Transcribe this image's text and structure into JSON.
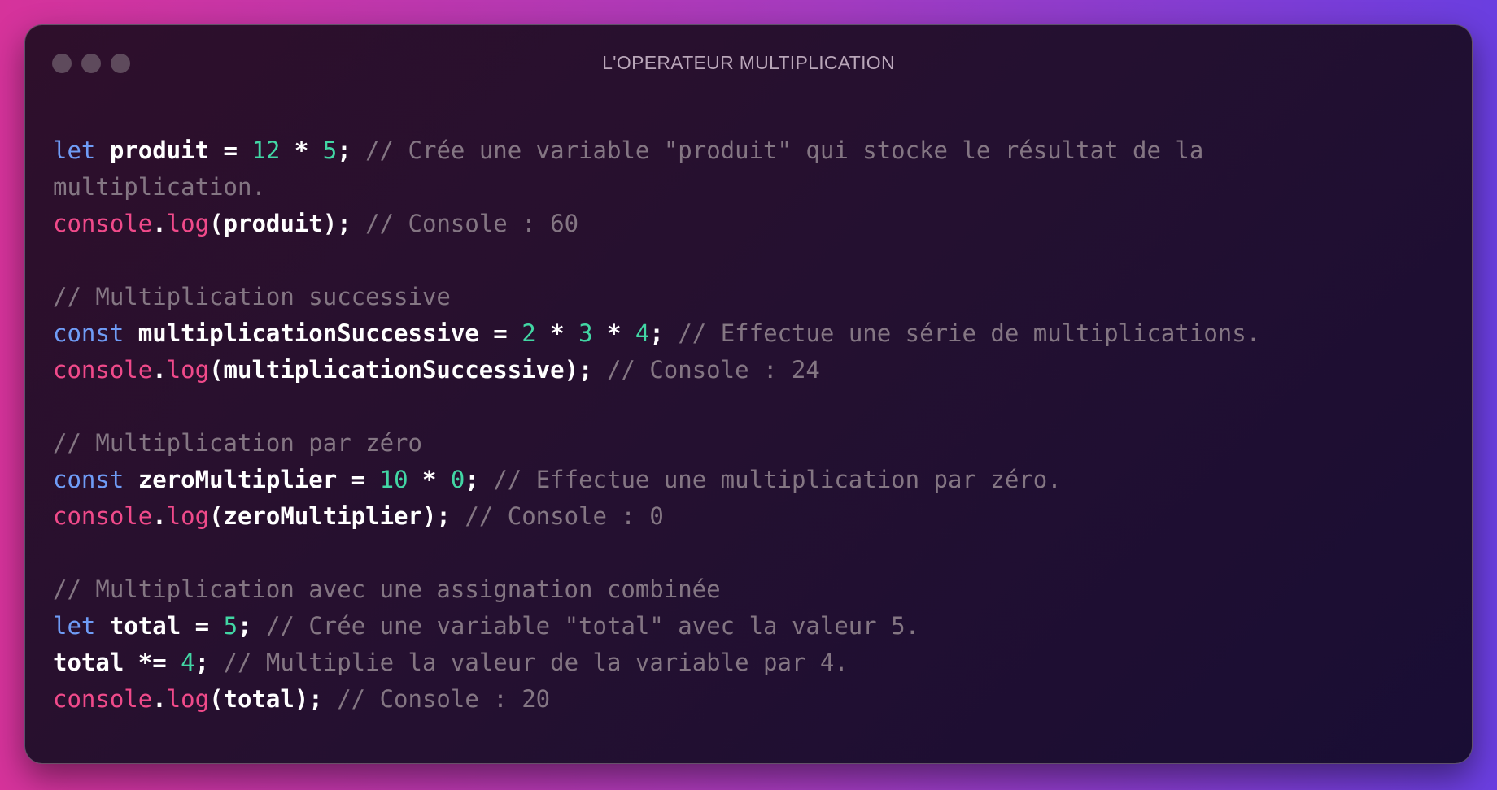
{
  "window": {
    "title": "L'OPERATEUR MULTIPLICATION"
  },
  "code": {
    "lines": [
      [
        {
          "t": "let",
          "k": "kw"
        },
        {
          "t": " ",
          "k": "punc"
        },
        {
          "t": "produit",
          "k": "id"
        },
        {
          "t": " = ",
          "k": "op"
        },
        {
          "t": "12",
          "k": "num"
        },
        {
          "t": " * ",
          "k": "op"
        },
        {
          "t": "5",
          "k": "num"
        },
        {
          "t": "; ",
          "k": "punc"
        },
        {
          "t": "// Crée une variable \"produit\" qui stocke le résultat de la",
          "k": "cm"
        }
      ],
      [
        {
          "t": "multiplication.",
          "k": "cm"
        }
      ],
      [
        {
          "t": "console",
          "k": "obj"
        },
        {
          "t": ".",
          "k": "punc"
        },
        {
          "t": "log",
          "k": "fn"
        },
        {
          "t": "(produit); ",
          "k": "punc"
        },
        {
          "t": "// Console : 60",
          "k": "cm"
        }
      ],
      [],
      [
        {
          "t": "// Multiplication successive",
          "k": "cm"
        }
      ],
      [
        {
          "t": "const",
          "k": "kw"
        },
        {
          "t": " ",
          "k": "punc"
        },
        {
          "t": "multiplicationSuccessive",
          "k": "id"
        },
        {
          "t": " = ",
          "k": "op"
        },
        {
          "t": "2",
          "k": "num"
        },
        {
          "t": " * ",
          "k": "op"
        },
        {
          "t": "3",
          "k": "num"
        },
        {
          "t": " * ",
          "k": "op"
        },
        {
          "t": "4",
          "k": "num"
        },
        {
          "t": "; ",
          "k": "punc"
        },
        {
          "t": "// Effectue une série de multiplications.",
          "k": "cm"
        }
      ],
      [
        {
          "t": "console",
          "k": "obj"
        },
        {
          "t": ".",
          "k": "punc"
        },
        {
          "t": "log",
          "k": "fn"
        },
        {
          "t": "(multiplicationSuccessive); ",
          "k": "punc"
        },
        {
          "t": "// Console : 24",
          "k": "cm"
        }
      ],
      [],
      [
        {
          "t": "// Multiplication par zéro",
          "k": "cm"
        }
      ],
      [
        {
          "t": "const",
          "k": "kw"
        },
        {
          "t": " ",
          "k": "punc"
        },
        {
          "t": "zeroMultiplier",
          "k": "id"
        },
        {
          "t": " = ",
          "k": "op"
        },
        {
          "t": "10",
          "k": "num"
        },
        {
          "t": " * ",
          "k": "op"
        },
        {
          "t": "0",
          "k": "num"
        },
        {
          "t": "; ",
          "k": "punc"
        },
        {
          "t": "// Effectue une multiplication par zéro.",
          "k": "cm"
        }
      ],
      [
        {
          "t": "console",
          "k": "obj"
        },
        {
          "t": ".",
          "k": "punc"
        },
        {
          "t": "log",
          "k": "fn"
        },
        {
          "t": "(zeroMultiplier); ",
          "k": "punc"
        },
        {
          "t": "// Console : 0",
          "k": "cm"
        }
      ],
      [],
      [
        {
          "t": "// Multiplication avec une assignation combinée",
          "k": "cm"
        }
      ],
      [
        {
          "t": "let",
          "k": "kw"
        },
        {
          "t": " ",
          "k": "punc"
        },
        {
          "t": "total",
          "k": "id"
        },
        {
          "t": " = ",
          "k": "op"
        },
        {
          "t": "5",
          "k": "num"
        },
        {
          "t": "; ",
          "k": "punc"
        },
        {
          "t": "// Crée une variable \"total\" avec la valeur 5.",
          "k": "cm"
        }
      ],
      [
        {
          "t": "total",
          "k": "id"
        },
        {
          "t": " *= ",
          "k": "op"
        },
        {
          "t": "4",
          "k": "num"
        },
        {
          "t": "; ",
          "k": "punc"
        },
        {
          "t": "// Multiplie la valeur de la variable par 4.",
          "k": "cm"
        }
      ],
      [
        {
          "t": "console",
          "k": "obj"
        },
        {
          "t": ".",
          "k": "punc"
        },
        {
          "t": "log",
          "k": "fn"
        },
        {
          "t": "(total); ",
          "k": "punc"
        },
        {
          "t": "// Console : 20",
          "k": "cm"
        }
      ]
    ]
  }
}
